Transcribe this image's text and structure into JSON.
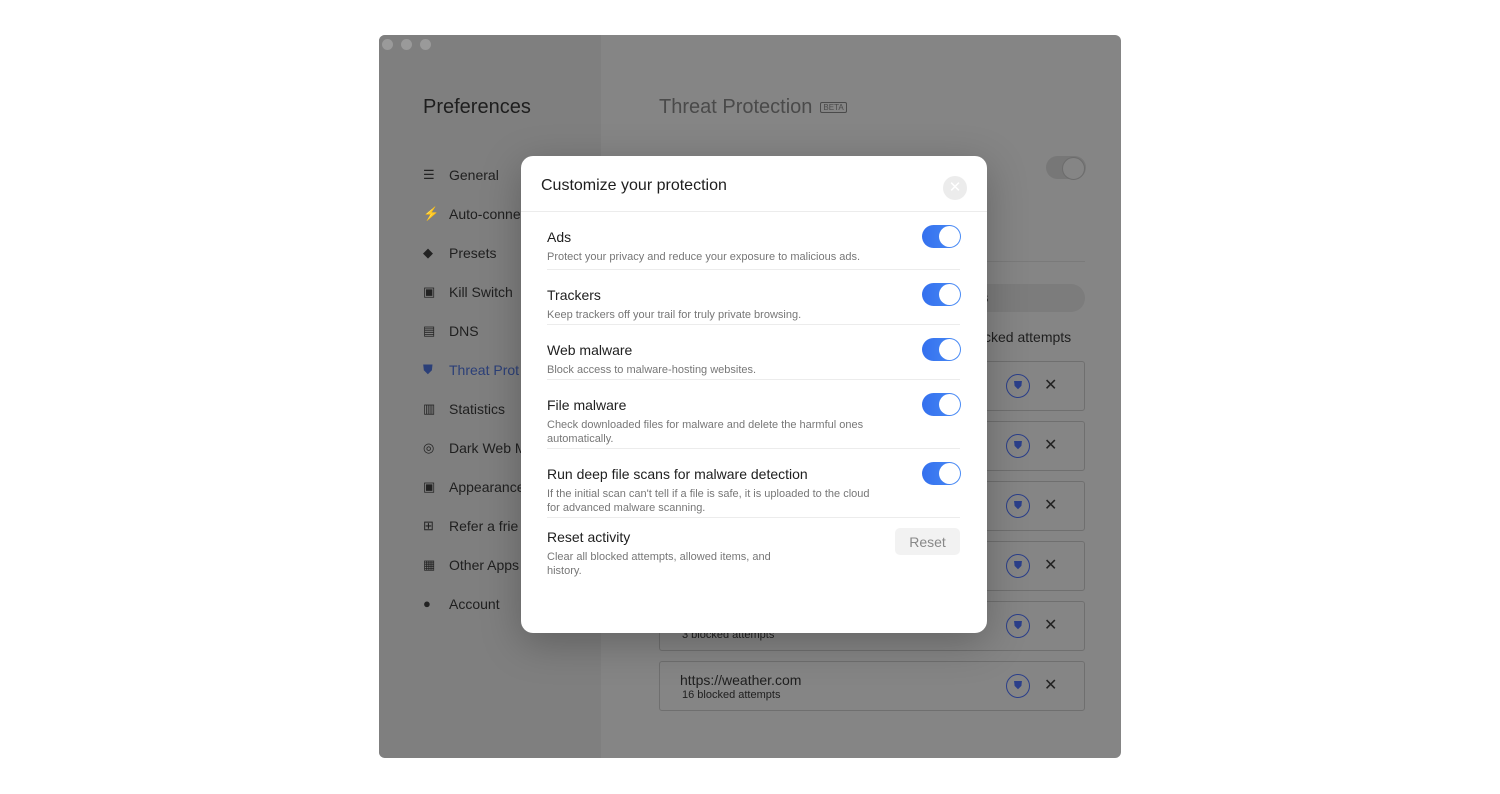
{
  "sidebar": {
    "title": "Preferences",
    "items": [
      {
        "label": "General",
        "icon": "sliders-icon"
      },
      {
        "label": "Auto-conne",
        "icon": "wifi-icon"
      },
      {
        "label": "Presets",
        "icon": "layers-icon"
      },
      {
        "label": "Kill Switch",
        "icon": "kill-switch-icon"
      },
      {
        "label": "DNS",
        "icon": "server-icon"
      },
      {
        "label": "Threat Prot",
        "icon": "shield-icon",
        "active": true
      },
      {
        "label": "Statistics",
        "icon": "bar-chart-icon"
      },
      {
        "label": "Dark Web M",
        "icon": "target-icon"
      },
      {
        "label": "Appearance",
        "icon": "window-icon"
      },
      {
        "label": "Refer a frie",
        "icon": "gift-icon"
      },
      {
        "label": "Other Apps",
        "icon": "apps-icon"
      },
      {
        "label": "Account",
        "icon": "user-icon"
      }
    ]
  },
  "main": {
    "title": "Threat Protection",
    "badge": "BETA",
    "pill_fragment": "s",
    "blocked_heading_fragment": "cked attempts",
    "rows": [
      {
        "url": "",
        "count": ""
      },
      {
        "url": "",
        "count": ""
      },
      {
        "url": "",
        "count": ""
      },
      {
        "url": "",
        "count": ""
      },
      {
        "url": "",
        "count": "3 blocked attempts"
      },
      {
        "url": "https://weather.com",
        "count": "16 blocked attempts"
      }
    ]
  },
  "modal": {
    "title": "Customize your protection",
    "options": [
      {
        "label": "Ads",
        "desc": "Protect your privacy and reduce your exposure to malicious ads.",
        "on": true
      },
      {
        "label": "Trackers",
        "desc": "Keep trackers off your trail for truly private browsing.",
        "on": true
      },
      {
        "label": "Web malware",
        "desc": "Block access to malware-hosting websites.",
        "on": true
      },
      {
        "label": "File malware",
        "desc": "Check downloaded files for malware and delete the harmful ones automatically.",
        "on": true
      },
      {
        "label": "Run deep file scans for malware detection",
        "desc": "If the initial scan can't tell if a file is safe, it is uploaded to the cloud for advanced malware scanning.",
        "on": true
      }
    ],
    "reset": {
      "label": "Reset activity",
      "desc": "Clear all blocked attempts, allowed items, and history.",
      "button": "Reset"
    }
  },
  "colors": {
    "accent": "#3b7ff2",
    "overlay": "#858585"
  }
}
